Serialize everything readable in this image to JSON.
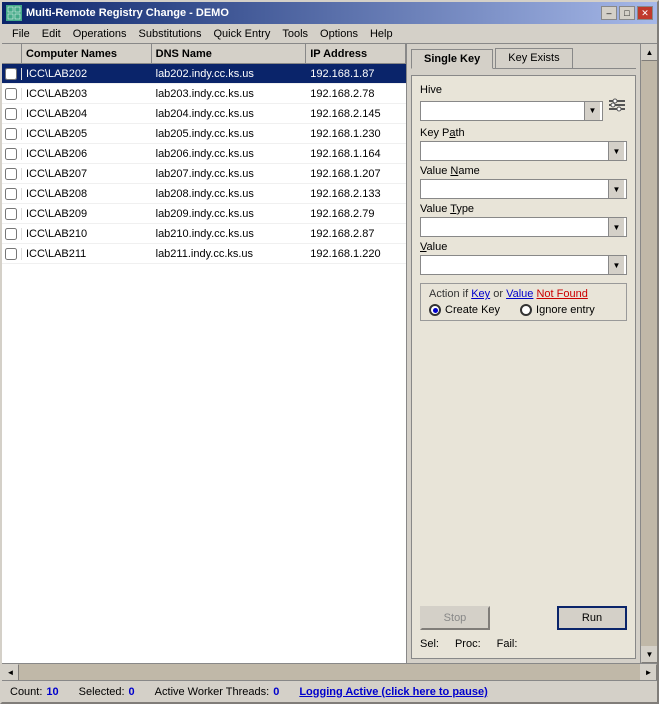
{
  "titleBar": {
    "title": "Multi-Remote Registry Change - DEMO",
    "minimizeBtn": "–",
    "maximizeBtn": "□",
    "closeBtn": "✕"
  },
  "menuBar": {
    "items": [
      "File",
      "Edit",
      "Operations",
      "Substitutions",
      "Quick Entry",
      "Tools",
      "Options",
      "Help"
    ]
  },
  "listPanel": {
    "columns": [
      "",
      "Computer Names",
      "DNS Name",
      "IP Address"
    ],
    "rows": [
      {
        "check": false,
        "computer": "ICC\\LAB202",
        "dns": "lab202.indy.cc.ks.us",
        "ip": "192.168.1.87",
        "selected": true
      },
      {
        "check": false,
        "computer": "ICC\\LAB203",
        "dns": "lab203.indy.cc.ks.us",
        "ip": "192.168.2.78",
        "selected": false
      },
      {
        "check": false,
        "computer": "ICC\\LAB204",
        "dns": "lab204.indy.cc.ks.us",
        "ip": "192.168.2.145",
        "selected": false
      },
      {
        "check": false,
        "computer": "ICC\\LAB205",
        "dns": "lab205.indy.cc.ks.us",
        "ip": "192.168.1.230",
        "selected": false
      },
      {
        "check": false,
        "computer": "ICC\\LAB206",
        "dns": "lab206.indy.cc.ks.us",
        "ip": "192.168.1.164",
        "selected": false
      },
      {
        "check": false,
        "computer": "ICC\\LAB207",
        "dns": "lab207.indy.cc.ks.us",
        "ip": "192.168.1.207",
        "selected": false
      },
      {
        "check": false,
        "computer": "ICC\\LAB208",
        "dns": "lab208.indy.cc.ks.us",
        "ip": "192.168.2.133",
        "selected": false
      },
      {
        "check": false,
        "computer": "ICC\\LAB209",
        "dns": "lab209.indy.cc.ks.us",
        "ip": "192.168.2.79",
        "selected": false
      },
      {
        "check": false,
        "computer": "ICC\\LAB210",
        "dns": "lab210.indy.cc.ks.us",
        "ip": "192.168.2.87",
        "selected": false
      },
      {
        "check": false,
        "computer": "ICC\\LAB211",
        "dns": "lab211.indy.cc.ks.us",
        "ip": "192.168.1.220",
        "selected": false
      }
    ]
  },
  "rightPanel": {
    "tabs": [
      {
        "label": "Single Key",
        "active": true
      },
      {
        "label": "Key Exists",
        "active": false
      }
    ],
    "form": {
      "hiveLabel": "Hive",
      "hiveValue": "",
      "keyPathLabel": "Key Path",
      "keyPathValue": "",
      "valueNameLabel": "Value Name",
      "valueNameValue": "",
      "valueTypeLabel": "Value Type",
      "valueTypeValue": "",
      "valueLabel": "Value",
      "valueValue": ""
    },
    "actionSection": {
      "title": "Action if Key or Value Not Found",
      "titleKeyText": "Key",
      "titleValueText": "Value",
      "titleNotFoundText": "Not Found",
      "options": [
        {
          "label": "Create Key",
          "selected": true
        },
        {
          "label": "Ignore entry",
          "selected": false
        }
      ]
    },
    "buttons": {
      "stopLabel": "Stop",
      "runLabel": "Run"
    }
  },
  "statusBar": {
    "selLabel": "Sel:",
    "selValue": "",
    "procLabel": "Proc:",
    "procValue": "",
    "failLabel": "Fail:",
    "failValue": ""
  },
  "bottomBar": {
    "countLabel": "Count:",
    "countValue": "10",
    "selectedLabel": "Selected:",
    "selectedValue": "0",
    "workersLabel": "Active Worker Threads:",
    "workersValue": "0",
    "loggingLabel": "Logging Active (click here to pause)"
  }
}
